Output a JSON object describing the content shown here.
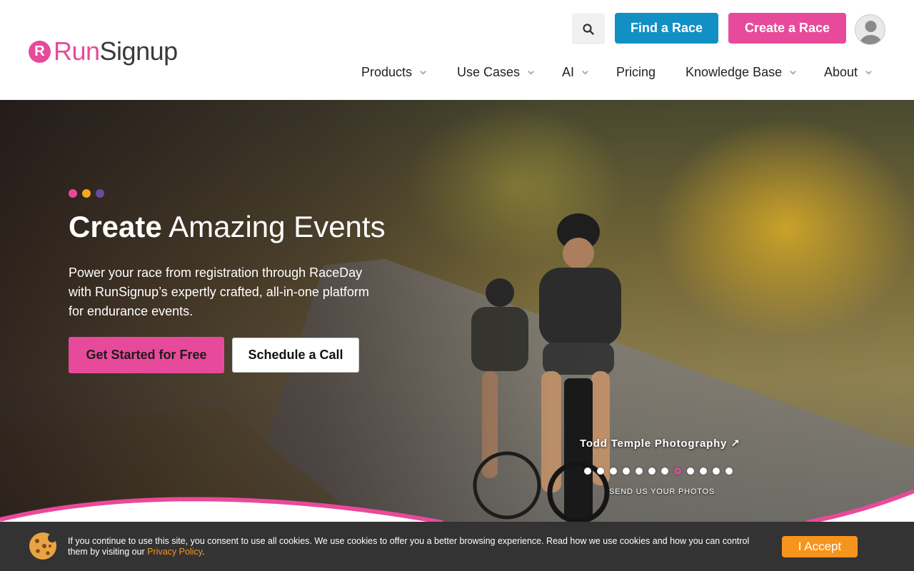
{
  "header": {
    "logo_mark": "R",
    "logo_run": "Run",
    "logo_signup": "Signup",
    "find_race": "Find a Race",
    "create_race": "Create a Race"
  },
  "nav": {
    "items": [
      {
        "label": "Products",
        "dropdown": true
      },
      {
        "label": "Use Cases",
        "dropdown": true
      },
      {
        "label": "AI",
        "dropdown": true
      },
      {
        "label": "Pricing",
        "dropdown": false
      },
      {
        "label": "Knowledge Base",
        "dropdown": true
      },
      {
        "label": "About",
        "dropdown": true
      }
    ]
  },
  "hero": {
    "title_bold": "Create",
    "title_rest": "Amazing Events",
    "subtitle": "Power your race from registration through RaceDay with RunSignup’s expertly crafted, all-in-one platform for endurance events.",
    "cta_primary": "Get Started for Free",
    "cta_secondary": "Schedule a Call",
    "photo_credit": "Todd Temple Photography ↗",
    "send_photos": "SEND US YOUR PHOTOS",
    "slides_total": 12,
    "active_slide": 8
  },
  "cookie": {
    "text": "If you continue to use this site, you consent to use all cookies. We use cookies to offer you a better browsing experience. Read how we use cookies and how you can control them by visiting our ",
    "privacy_link": "Privacy Policy",
    "end": ".",
    "accept": "I Accept"
  },
  "colors": {
    "brand_pink": "#e84a9b",
    "brand_blue": "#1190c4",
    "accent_orange": "#f7941d",
    "dot_yellow": "#f5a623",
    "dot_purple": "#6a4c9c"
  },
  "icons": [
    "search-icon",
    "user-avatar-icon",
    "chevron-down-icon",
    "cookie-icon"
  ]
}
